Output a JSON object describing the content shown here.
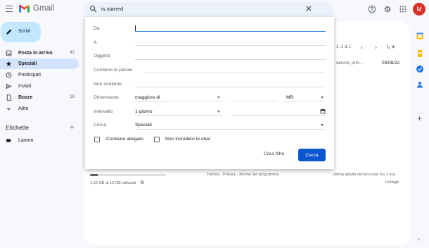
{
  "header": {
    "brand": "Gmail",
    "search_value": "is:starred",
    "avatar_initial": "M"
  },
  "compose": {
    "label": "Scrivi"
  },
  "nav": {
    "items": [
      {
        "label": "Posta in arrivo",
        "count": "42",
        "bold": true,
        "icon": "inbox-icon"
      },
      {
        "label": "Speciali",
        "count": "",
        "bold": false,
        "active": true,
        "icon": "star-icon"
      },
      {
        "label": "Posticipati",
        "count": "",
        "bold": false,
        "icon": "clock-icon"
      },
      {
        "label": "Inviati",
        "count": "",
        "bold": false,
        "icon": "send-icon"
      },
      {
        "label": "Bozze",
        "count": "19",
        "bold": true,
        "icon": "draft-icon"
      },
      {
        "label": "Altro",
        "count": "",
        "bold": false,
        "icon": "chevron-down-icon"
      }
    ],
    "labels_title": "Etichette",
    "labels": [
      {
        "label": "Lavoro",
        "icon": "label-icon"
      }
    ]
  },
  "main": {
    "pager": "1–1 di 1",
    "snippet": "servizi, prin...",
    "date": "03/08/22",
    "storage": "1,55 GB di 15 GB utilizzati",
    "storage_fraction": 0.1,
    "footer_links": "Termini · Privacy · Norme del programma",
    "activity": "Ultima attività dell'account: tra 1 ora",
    "details": "Dettagli"
  },
  "search_panel": {
    "from_label": "Da",
    "to_label": "A",
    "subject_label": "Oggetto",
    "has_words_label": "Contiene le parole",
    "not_has_label": "Non contiene",
    "size_label": "Dimensione",
    "size_operator": "maggiore di",
    "size_unit": "MB",
    "interval_label": "Intervallo",
    "interval_value": "1 giorno",
    "search_in_label": "Cerca",
    "search_in_value": "Speciali",
    "attachment_label": "Contiene allegato",
    "no_chats_label": "Non includere le chat",
    "create_filter": "Crea filtro",
    "search_button": "Cerca"
  },
  "colors": {
    "compose_bg": "#c2e7ff",
    "active_nav": "#d3e3fd",
    "primary_button": "#0b57d0",
    "focus_line": "#1a73e8",
    "avatar": "#d93025"
  }
}
